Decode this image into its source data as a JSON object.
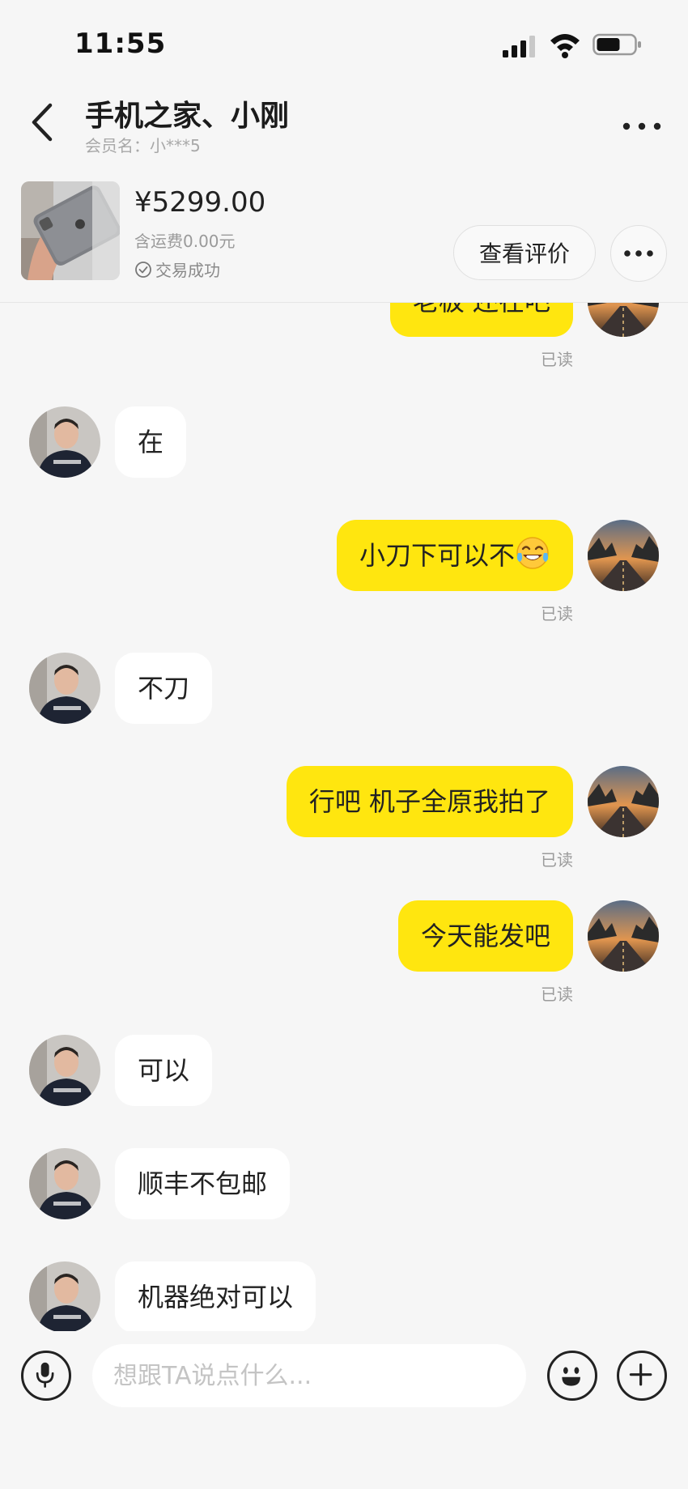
{
  "status_bar": {
    "time": "11:55",
    "icons": [
      "signal-icon",
      "wifi-icon",
      "battery-icon"
    ]
  },
  "header": {
    "title": "手机之家、小刚",
    "subtitle": "会员名：小***5",
    "icons": [
      "back-arrow-icon",
      "more-dots-icon"
    ]
  },
  "product": {
    "price": "¥5299.00",
    "shipping": "含运费0.00元",
    "status": "交易成功",
    "review_button": "查看评价",
    "image_alt": "ipad-product-photo"
  },
  "messages": [
    {
      "side": "out",
      "text": "老板 还在吧",
      "read": "已读"
    },
    {
      "side": "in",
      "text": "在"
    },
    {
      "side": "out",
      "text": "小刀下可以不",
      "emoji": "tears-of-joy-emoji",
      "read": "已读"
    },
    {
      "side": "in",
      "text": "不刀"
    },
    {
      "side": "out",
      "text": "行吧 机子全原我拍了",
      "read": "已读"
    },
    {
      "side": "out",
      "text": "今天能发吧",
      "read": "已读"
    },
    {
      "side": "in",
      "text": "可以"
    },
    {
      "side": "in",
      "text": "顺丰不包邮"
    },
    {
      "side": "in",
      "text": "机器绝对可以"
    }
  ],
  "input_bar": {
    "placeholder": "想跟TA说点什么...",
    "icons": [
      "microphone-icon",
      "smiley-face-icon",
      "plus-circle-icon"
    ]
  },
  "colors": {
    "background": "#f6f6f6",
    "outgoing_bubble": "#ffe60f",
    "incoming_bubble": "#ffffff",
    "muted_text": "#9b9b9b"
  }
}
